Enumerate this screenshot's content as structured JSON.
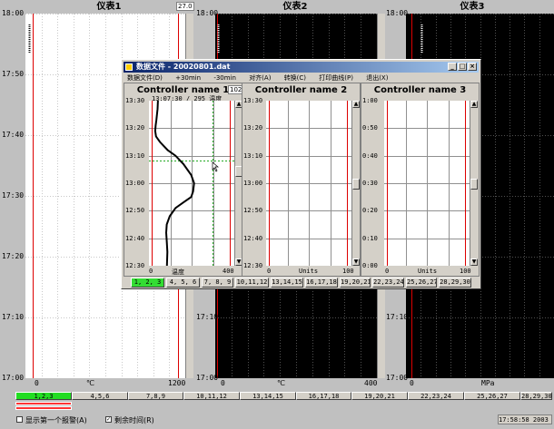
{
  "panels": [
    {
      "title": "仪表1",
      "unit": "℃",
      "x_min": "0",
      "x_max": "1200",
      "corner": "27.0"
    },
    {
      "title": "仪表2",
      "unit": "℃",
      "x_min": "0",
      "x_max": "400"
    },
    {
      "title": "仪表3",
      "unit": "MPa",
      "x_min": "0",
      "x_max": ""
    }
  ],
  "time_labels": [
    "18:00",
    "17:50",
    "17:40",
    "17:30",
    "17:20",
    "17:10",
    "17:00"
  ],
  "window": {
    "title": "数据文件 - 20020801.dat",
    "menu": [
      "数据文件(D)",
      "+30min",
      "-30min",
      "对齐(A)",
      "转换(C)",
      "打印曲线(P)",
      "退出(X)"
    ],
    "controllers": [
      {
        "name": "Controller name  1",
        "cursor_text": "13:07:30 / 295 温度",
        "corner": "102",
        "x_min": "0",
        "x_max": "400",
        "unit": "温度",
        "y_labels": [
          "13:30",
          "13:20",
          "13:10",
          "13:00",
          "12:50",
          "12:40",
          "12:30"
        ]
      },
      {
        "name": "Controller name  2",
        "x_min": "0",
        "x_max": "100",
        "unit": "Units",
        "y_labels": [
          "13:30",
          "13:20",
          "13:10",
          "13:00",
          "12:50",
          "12:40",
          "12:30"
        ]
      },
      {
        "name": "Controller name  3",
        "x_min": "0",
        "x_max": "100",
        "unit": "Units",
        "y_labels": [
          "1:00",
          "0:50",
          "0:40",
          "0:30",
          "0:20",
          "0:10",
          "0:00"
        ]
      }
    ],
    "buttons": [
      "1, 2, 3",
      "4, 5, 6",
      "7, 8, 9",
      "10,11,12",
      "13,14,15",
      "16,17,18",
      "19,20,21",
      "22,23,24",
      "25,26,27",
      "28,29,30"
    ]
  },
  "bottom_buttons": [
    "1,2,3",
    "4,5,6",
    "7,8,9",
    "10,11,12",
    "13,14,15",
    "16,17,18",
    "19,20,21",
    "22,23,24",
    "25,26,27",
    "28,29,30"
  ],
  "status": {
    "show_first_alarm": "显示第一个报警(A)",
    "remaining_time": "剩余时间(R)",
    "clock": "17:58:58 2003"
  },
  "chart_data": {
    "type": "line",
    "title": "Controller name  1",
    "xlabel": "温度",
    "xlim": [
      0,
      400
    ],
    "ylim_time": [
      "12:30",
      "13:30"
    ],
    "series": [
      {
        "x": [
          30,
          28,
          22,
          18,
          16,
          20,
          40,
          80,
          120,
          160,
          200,
          215,
          210,
          200,
          160,
          120,
          90,
          75,
          72,
          75,
          78,
          76
        ],
        "y": [
          "13:30",
          "13:27",
          "13:23",
          "13:21",
          "13:19",
          "13:17",
          "13:15",
          "13:12",
          "13:10",
          "13:07",
          "13:03",
          "13:00",
          "12:57",
          "12:55",
          "12:53",
          "12:51",
          "12:48",
          "12:45",
          "12:42",
          "12:39",
          "12:35",
          "12:30"
        ]
      }
    ]
  }
}
